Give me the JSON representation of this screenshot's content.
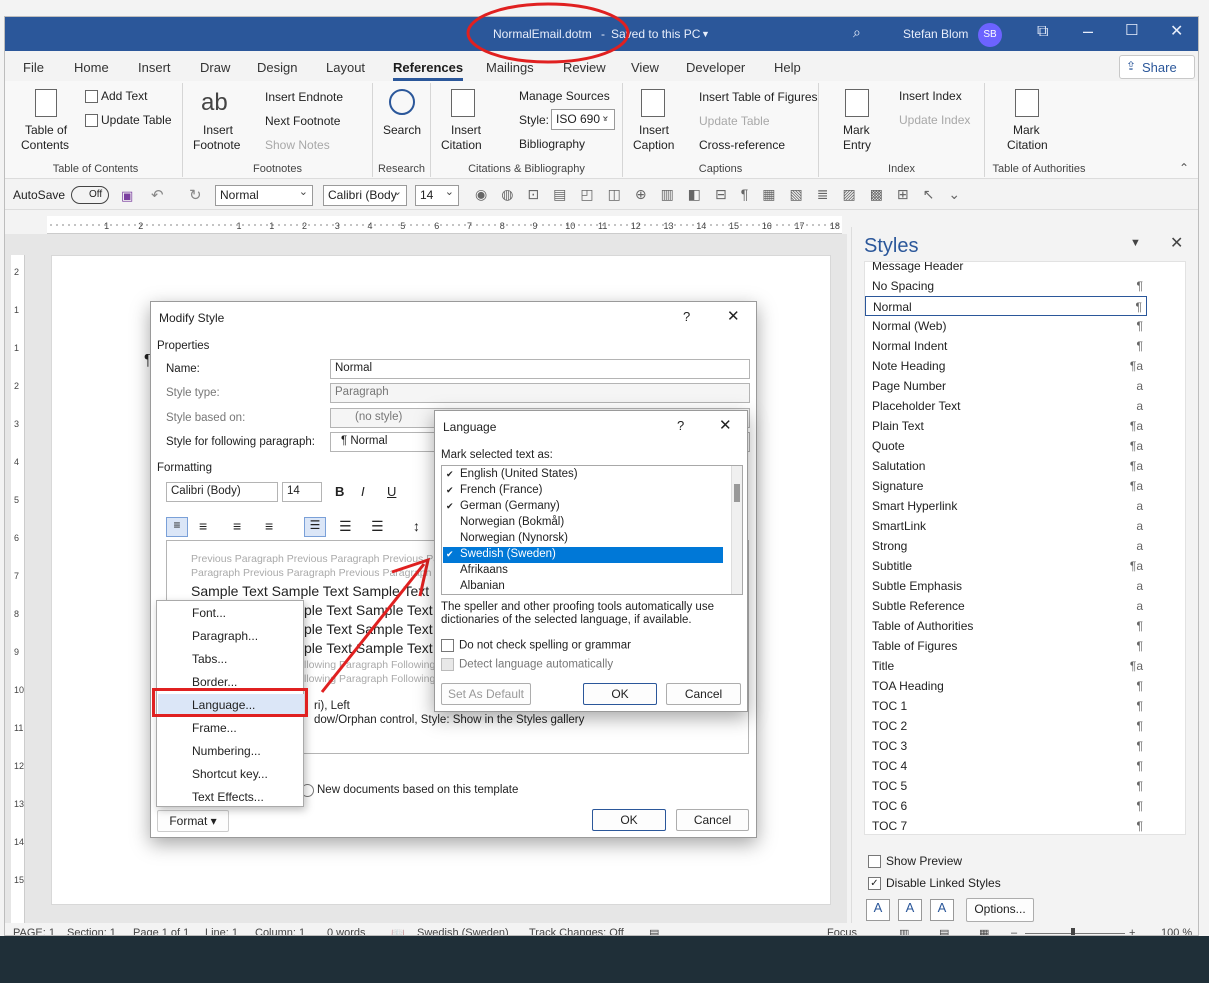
{
  "window": {
    "title_doc": "NormalEmail.dotm",
    "title_sep": "-",
    "title_saved": "Saved to this PC",
    "user_name": "Stefan Blom",
    "user_initials": "SB"
  },
  "ribbon_tabs": [
    "File",
    "Home",
    "Insert",
    "Draw",
    "Design",
    "Layout",
    "References",
    "Mailings",
    "Review",
    "View",
    "Developer",
    "Help"
  ],
  "share_label": "Share",
  "ribbon": {
    "toc": {
      "btn1": "Table of",
      "btn2": "Contents",
      "add_text": "Add Text",
      "update_table": "Update Table",
      "group": "Table of Contents"
    },
    "footnotes": {
      "insert1": "Insert",
      "insert2": "Footnote",
      "insert_endnote": "Insert Endnote",
      "next_footnote": "Next Footnote",
      "show_notes": "Show Notes",
      "group": "Footnotes",
      "icon_text": "ab"
    },
    "research": {
      "search": "Search",
      "group": "Research"
    },
    "citations": {
      "insert1": "Insert",
      "insert2": "Citation",
      "manage_sources": "Manage Sources",
      "style_label": "Style:",
      "style_value": "ISO 690 -",
      "bibliography": "Bibliography",
      "group": "Citations & Bibliography"
    },
    "captions": {
      "insert1": "Insert",
      "insert2": "Caption",
      "insert_tof": "Insert Table of Figures",
      "update_table": "Update Table",
      "cross_ref": "Cross-reference",
      "group": "Captions"
    },
    "index": {
      "mark1": "Mark",
      "mark2": "Entry",
      "insert_index": "Insert Index",
      "update_index": "Update Index",
      "group": "Index"
    },
    "toa": {
      "mark1": "Mark",
      "mark2": "Citation",
      "group": "Table of Authorities"
    }
  },
  "qat": {
    "autosave": "AutoSave",
    "toggle": "Off",
    "style_box": "Normal",
    "font_box": "Calibri (Body",
    "size_box": "14"
  },
  "ruler_nums": [
    "1",
    "2",
    "1",
    "1",
    "2",
    "3",
    "4",
    "5",
    "6",
    "7",
    "8",
    "9",
    "10",
    "11",
    "12",
    "13",
    "14",
    "15",
    "16",
    "17",
    "18"
  ],
  "vruler_nums": [
    "2",
    "1",
    "1",
    "2",
    "3",
    "4",
    "5",
    "6",
    "7",
    "8",
    "9",
    "10",
    "11",
    "12",
    "13",
    "14",
    "15"
  ],
  "styles_pane": {
    "title": "Styles",
    "items": [
      {
        "name": "Message Header",
        "mark": ""
      },
      {
        "name": "No Spacing",
        "mark": "¶"
      },
      {
        "name": "Normal",
        "mark": "¶"
      },
      {
        "name": "Normal (Web)",
        "mark": "¶"
      },
      {
        "name": "Normal Indent",
        "mark": "¶"
      },
      {
        "name": "Note Heading",
        "mark": "¶a"
      },
      {
        "name": "Page Number",
        "mark": "a"
      },
      {
        "name": "Placeholder Text",
        "mark": "a"
      },
      {
        "name": "Plain Text",
        "mark": "¶a"
      },
      {
        "name": "Quote",
        "mark": "¶a"
      },
      {
        "name": "Salutation",
        "mark": "¶a"
      },
      {
        "name": "Signature",
        "mark": "¶a"
      },
      {
        "name": "Smart Hyperlink",
        "mark": "a"
      },
      {
        "name": "SmartLink",
        "mark": "a"
      },
      {
        "name": "Strong",
        "mark": "a"
      },
      {
        "name": "Subtitle",
        "mark": "¶a"
      },
      {
        "name": "Subtle Emphasis",
        "mark": "a"
      },
      {
        "name": "Subtle Reference",
        "mark": "a"
      },
      {
        "name": "Table of Authorities",
        "mark": "¶"
      },
      {
        "name": "Table of Figures",
        "mark": "¶"
      },
      {
        "name": "Title",
        "mark": "¶a"
      },
      {
        "name": "TOA Heading",
        "mark": "¶"
      },
      {
        "name": "TOC 1",
        "mark": "¶"
      },
      {
        "name": "TOC 2",
        "mark": "¶"
      },
      {
        "name": "TOC 3",
        "mark": "¶"
      },
      {
        "name": "TOC 4",
        "mark": "¶"
      },
      {
        "name": "TOC 5",
        "mark": "¶"
      },
      {
        "name": "TOC 6",
        "mark": "¶"
      },
      {
        "name": "TOC 7",
        "mark": "¶"
      }
    ],
    "show_preview": "Show Preview",
    "disable_linked": "Disable Linked Styles",
    "options": "Options..."
  },
  "modify_style": {
    "title": "Modify Style",
    "help": "?",
    "properties": "Properties",
    "name_label": "Name:",
    "name_value": "Normal",
    "type_label": "Style type:",
    "type_value": "Paragraph",
    "based_label": "Style based on:",
    "based_value": "(no style)",
    "following_label": "Style for following paragraph:",
    "following_value": "¶  Normal",
    "formatting": "Formatting",
    "font_value": "Calibri (Body)",
    "size_value": "14",
    "prev_para": "Previous Paragraph Previous Paragraph Previous Paragraph Previous Paragraph Previous",
    "prev_para2": "Paragraph Previous Paragraph Previous Paragraph Previous",
    "sample": "Sample Text Sample Text Sample Text",
    "sample_b": "ple Text Sample Text",
    "following": "llowing Paragraph Following",
    "desc1": "ri), Left",
    "desc2": "dow/Orphan control, Style: Show in the Styles gallery",
    "new_docs": "New documents based on this template",
    "format_btn": "Format",
    "ok": "OK",
    "cancel": "Cancel"
  },
  "format_menu": [
    "Font...",
    "Paragraph...",
    "Tabs...",
    "Border...",
    "Language...",
    "Frame...",
    "Numbering...",
    "Shortcut key...",
    "Text Effects..."
  ],
  "language_dialog": {
    "title": "Language",
    "help": "?",
    "mark_label": "Mark selected text as:",
    "languages": [
      {
        "name": "English (United States)",
        "check": true
      },
      {
        "name": "French (France)",
        "check": true
      },
      {
        "name": "German (Germany)",
        "check": true
      },
      {
        "name": "Norwegian (Bokmål)",
        "check": false
      },
      {
        "name": "Norwegian (Nynorsk)",
        "check": false
      },
      {
        "name": "Swedish (Sweden)",
        "check": true
      },
      {
        "name": "Afrikaans",
        "check": false
      },
      {
        "name": "Albanian",
        "check": false
      }
    ],
    "info1": "The speller and other proofing tools automatically use",
    "info2": "dictionaries of the selected language, if available.",
    "no_check": "Do not check spelling or grammar",
    "detect": "Detect language automatically",
    "set_default": "Set As Default",
    "ok": "OK",
    "cancel": "Cancel"
  },
  "status_bar": {
    "page": "PAGE: 1",
    "section": "Section: 1",
    "page_of": "Page 1 of 1",
    "line": "Line: 1",
    "column": "Column: 1",
    "words": "0 words",
    "language": "Swedish (Sweden)",
    "track": "Track Changes: Off",
    "focus": "Focus",
    "zoom": "100 %"
  },
  "colors": {
    "accent": "#2b579a",
    "annotation": "#e02020",
    "selection": "#0078d7"
  }
}
